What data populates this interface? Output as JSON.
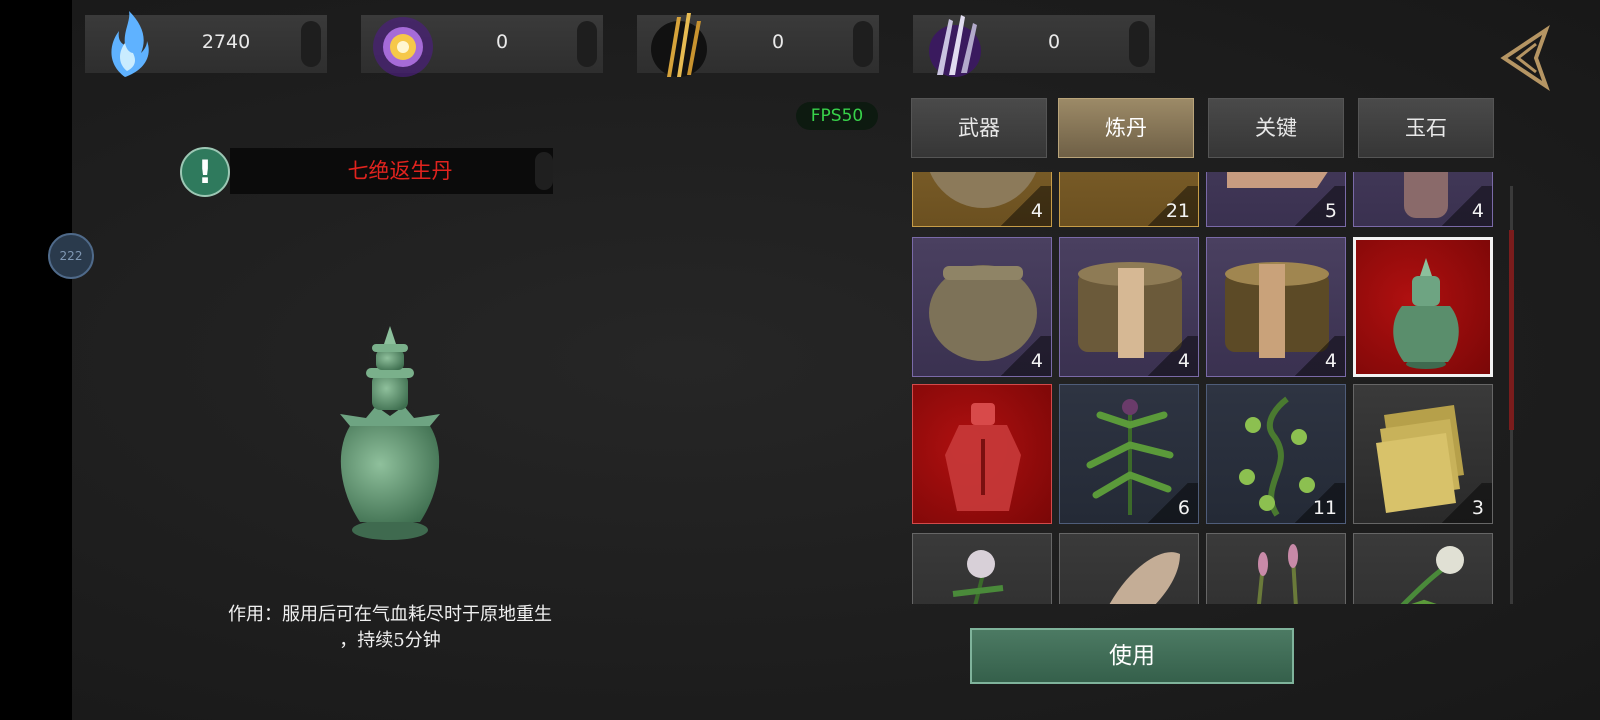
{
  "resources": [
    {
      "icon": "blue-flame-icon",
      "value": "2740"
    },
    {
      "icon": "purple-orb-icon",
      "value": "0"
    },
    {
      "icon": "golden-arrows-icon",
      "value": "0"
    },
    {
      "icon": "purple-blades-icon",
      "value": "0"
    }
  ],
  "fps": "FPS50",
  "tabs": [
    {
      "label": "武器",
      "active": false
    },
    {
      "label": "炼丹",
      "active": true
    },
    {
      "label": "关键",
      "active": false
    },
    {
      "label": "玉石",
      "active": false
    }
  ],
  "selected_item": {
    "name": "七绝返生丹",
    "description_line1": "作用：服用后可在气血耗尽时于原地重生",
    "description_line2": "，持续5分钟"
  },
  "side_button": "222",
  "use_button": "使用",
  "inventory": [
    {
      "count": "4",
      "rarity": "gold"
    },
    {
      "count": "21",
      "rarity": "gold"
    },
    {
      "count": "5",
      "rarity": "purple"
    },
    {
      "count": "4",
      "rarity": "purple"
    },
    {
      "count": "4",
      "rarity": "purple"
    },
    {
      "count": "4",
      "rarity": "purple"
    },
    {
      "count": "4",
      "rarity": "purple"
    },
    {
      "count": "",
      "rarity": "red"
    },
    {
      "count": "",
      "rarity": "red"
    },
    {
      "count": "6",
      "rarity": "blue"
    },
    {
      "count": "11",
      "rarity": "blue"
    },
    {
      "count": "3",
      "rarity": "gray"
    },
    {
      "count": "",
      "rarity": "gray"
    },
    {
      "count": "",
      "rarity": "gray"
    },
    {
      "count": "",
      "rarity": "gray"
    },
    {
      "count": "",
      "rarity": "gray"
    }
  ],
  "colors": {
    "accent_green": "#35604b",
    "item_name": "#e0231e",
    "fps_green": "#38d24a"
  }
}
